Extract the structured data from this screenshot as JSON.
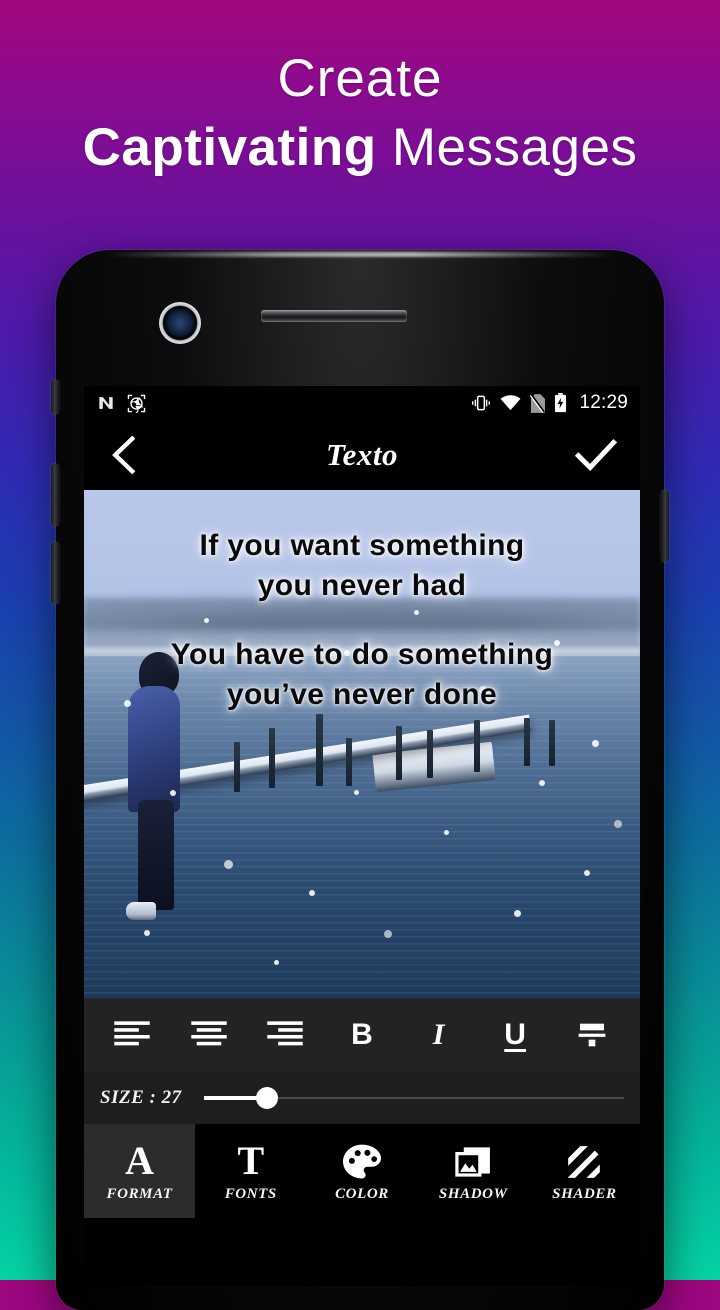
{
  "promo": {
    "line1": "Create",
    "line2_bold": "Captivating",
    "line2_rest": " Messages",
    "text_color": "#ffffff",
    "bg_gradient": [
      "#a2067e",
      "#4b1bac",
      "#1356a6",
      "#06d3a4"
    ]
  },
  "device": {
    "camera": "front-camera",
    "speaker": "earpiece-speaker"
  },
  "statusbar": {
    "left_icons": [
      "nougat-n-icon",
      "camera-shutter-icon"
    ],
    "right_icons": [
      "vibrate-icon",
      "wifi-icon",
      "no-sim-icon",
      "battery-charging-icon"
    ],
    "clock": "12:29"
  },
  "appbar": {
    "back_icon": "back-chevron-icon",
    "title": "Texto",
    "confirm_icon": "check-icon"
  },
  "canvas": {
    "quote_block_1": [
      "If you want something",
      "you never had"
    ],
    "quote_block_2": [
      "You have to do something",
      "you’ve never done"
    ],
    "text_color": "#0a0a0a",
    "glow_color": "#ffffff",
    "photo_description": "snowy-lake-dock-photo"
  },
  "format_toolbar": {
    "items": [
      {
        "name": "align-left-icon",
        "label": "Align left"
      },
      {
        "name": "align-center-icon",
        "label": "Align center"
      },
      {
        "name": "align-right-icon",
        "label": "Align right"
      },
      {
        "name": "bold-icon",
        "label": "B"
      },
      {
        "name": "italic-icon",
        "label": "I"
      },
      {
        "name": "underline-icon",
        "label": "U"
      },
      {
        "name": "strikethrough-icon",
        "label": "Strikethrough"
      }
    ]
  },
  "size_control": {
    "label": "SIZE : 27",
    "value": 27,
    "percent": 15
  },
  "tabs": [
    {
      "label": "FORMAT",
      "icon": "letter-a-icon",
      "glyph": "A",
      "active": true
    },
    {
      "label": "FONTS",
      "icon": "letter-t-icon",
      "glyph": "T",
      "active": false
    },
    {
      "label": "COLOR",
      "icon": "palette-icon",
      "glyph": "",
      "active": false
    },
    {
      "label": "SHADOW",
      "icon": "photo-stack-icon",
      "glyph": "",
      "active": false
    },
    {
      "label": "SHADER",
      "icon": "diagonal-stripes-icon",
      "glyph": "",
      "active": false
    }
  ]
}
